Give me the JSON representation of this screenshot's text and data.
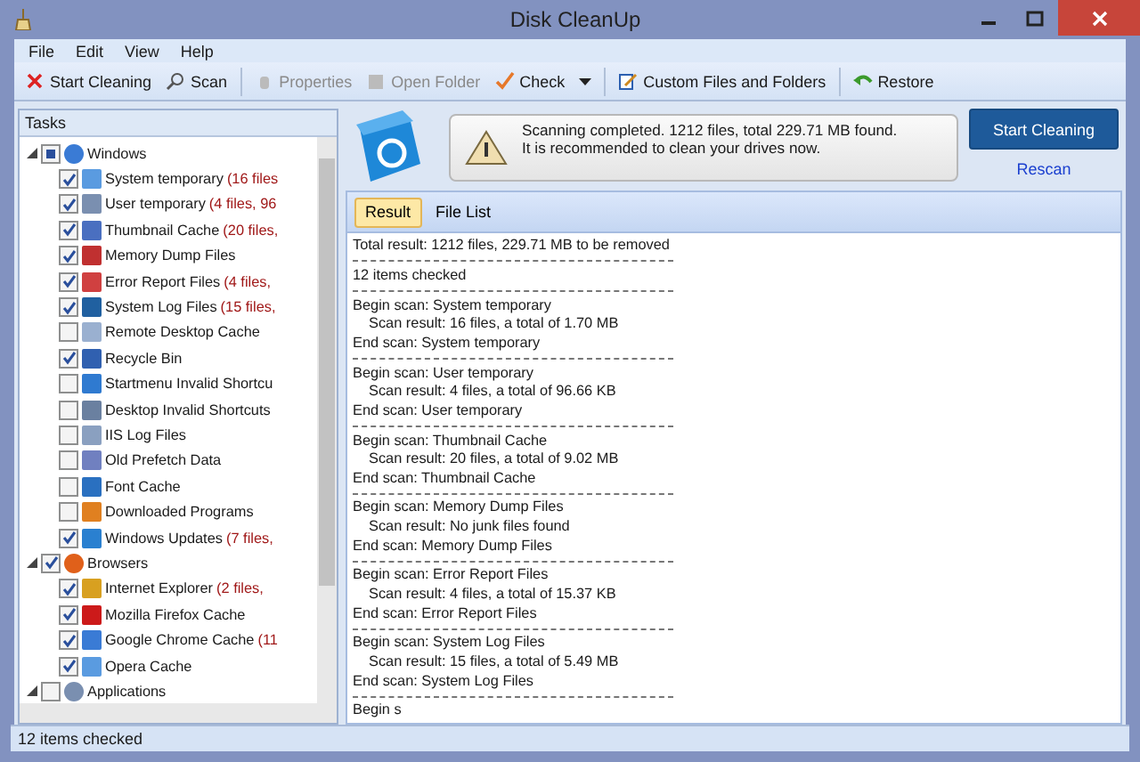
{
  "window": {
    "title": "Disk CleanUp"
  },
  "menu": [
    "File",
    "Edit",
    "View",
    "Help"
  ],
  "toolbar": [
    {
      "kind": "button",
      "label": "Start Cleaning",
      "disabled": false
    },
    {
      "kind": "button",
      "label": "Scan",
      "disabled": false
    },
    {
      "kind": "separator"
    },
    {
      "kind": "button",
      "label": "Properties",
      "disabled": true
    },
    {
      "kind": "button",
      "label": "Open Folder",
      "disabled": true
    },
    {
      "kind": "dropdown",
      "label": "Check",
      "disabled": false
    },
    {
      "kind": "separator"
    },
    {
      "kind": "button",
      "label": "Custom Files and Folders",
      "disabled": false
    },
    {
      "kind": "separator"
    },
    {
      "kind": "button",
      "label": "Restore",
      "disabled": false
    }
  ],
  "tasks": {
    "title": "Tasks",
    "tree": [
      {
        "label": "Windows",
        "expanded": true,
        "checked": false,
        "indeterminate": true,
        "children": [
          {
            "label": "System temporary",
            "detail": "(16 files",
            "checked": true
          },
          {
            "label": "User temporary",
            "detail": "(4 files, 96",
            "checked": true
          },
          {
            "label": "Thumbnail Cache",
            "detail": "(20 files,",
            "checked": true
          },
          {
            "label": "Memory Dump Files",
            "checked": true
          },
          {
            "label": "Error Report Files",
            "detail": "(4 files,",
            "checked": true
          },
          {
            "label": "System Log Files",
            "detail": "(15 files,",
            "checked": true
          },
          {
            "label": "Remote Desktop Cache",
            "checked": false
          },
          {
            "label": "Recycle Bin",
            "checked": true
          },
          {
            "label": "Startmenu Invalid Shortcu",
            "checked": false
          },
          {
            "label": "Desktop Invalid Shortcuts",
            "checked": false
          },
          {
            "label": "IIS Log Files",
            "checked": false
          },
          {
            "label": "Old Prefetch Data",
            "checked": false
          },
          {
            "label": "Font Cache",
            "checked": false
          },
          {
            "label": "Downloaded Programs",
            "checked": false
          },
          {
            "label": "Windows Updates",
            "detail": "(7 files,",
            "checked": true
          }
        ]
      },
      {
        "label": "Browsers",
        "expanded": true,
        "checked": true,
        "children": [
          {
            "label": "Internet Explorer",
            "detail": "(2 files,",
            "checked": true
          },
          {
            "label": "Mozilla Firefox Cache",
            "checked": true
          },
          {
            "label": "Google Chrome Cache",
            "detail": "(11",
            "checked": true
          },
          {
            "label": "Opera Cache",
            "checked": true
          }
        ]
      },
      {
        "label": "Applications",
        "expanded": true,
        "checked": false
      }
    ]
  },
  "notice": {
    "lines": [
      "Scanning completed. 1212 files, total 229.71 MB found.",
      "It is recommended to clean your drives now."
    ],
    "primary": "Start Cleaning",
    "link": "Rescan"
  },
  "tabs": [
    {
      "label": "Result",
      "selected": true
    },
    {
      "label": "File List",
      "selected": false
    }
  ],
  "log": [
    {
      "kind": "text",
      "text": "Total result: 1212 files, 229.71 MB to be removed"
    },
    {
      "kind": "divider"
    },
    {
      "kind": "text",
      "text": "12 items checked"
    },
    {
      "kind": "divider"
    },
    {
      "kind": "text",
      "text": "Begin scan: System temporary"
    },
    {
      "kind": "detail",
      "text": "Scan result:  16 files, a total of 1.70 MB"
    },
    {
      "kind": "text",
      "text": "End scan: System temporary"
    },
    {
      "kind": "divider"
    },
    {
      "kind": "text",
      "text": "Begin scan: User temporary"
    },
    {
      "kind": "detail",
      "text": "Scan result: 4 files, a total of 96.66 KB"
    },
    {
      "kind": "text",
      "text": "End scan: User temporary"
    },
    {
      "kind": "divider"
    },
    {
      "kind": "text",
      "text": "Begin scan: Thumbnail Cache"
    },
    {
      "kind": "detail",
      "text": "Scan result: 20 files, a total of 9.02 MB"
    },
    {
      "kind": "text",
      "text": "End scan: Thumbnail Cache"
    },
    {
      "kind": "divider"
    },
    {
      "kind": "text",
      "text": "Begin scan: Memory Dump Files"
    },
    {
      "kind": "detail",
      "text": "Scan result: No junk files found"
    },
    {
      "kind": "text",
      "text": "End scan: Memory Dump Files"
    },
    {
      "kind": "divider"
    },
    {
      "kind": "text",
      "text": "Begin scan: Error Report Files"
    },
    {
      "kind": "detail",
      "text": "Scan result: 4 files, a total of 15.37 KB"
    },
    {
      "kind": "text",
      "text": "End scan: Error Report Files"
    },
    {
      "kind": "divider"
    },
    {
      "kind": "text",
      "text": "Begin scan: System Log Files"
    },
    {
      "kind": "detail",
      "text": "Scan result:  15 files, a total of 5.49 MB"
    },
    {
      "kind": "text",
      "text": "End scan: System Log Files"
    },
    {
      "kind": "divider"
    },
    {
      "kind": "text",
      "text": "Begin s"
    }
  ],
  "status_bar": "12 items checked"
}
